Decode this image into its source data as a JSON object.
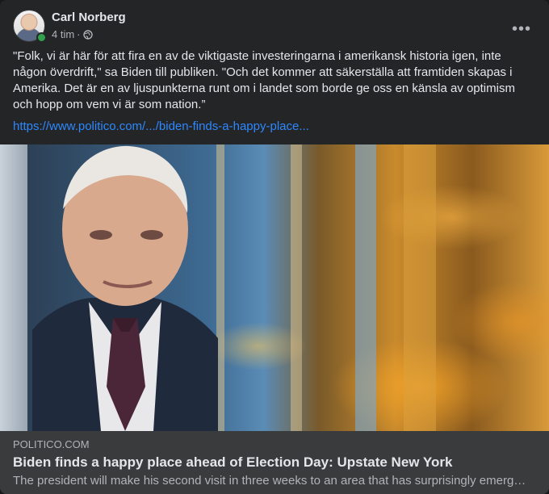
{
  "post": {
    "author": "Carl Norberg",
    "time": "4 tim",
    "separator": "·",
    "privacy_icon": "globe-icon",
    "more_icon": "•••",
    "text": "\"Folk, vi är här för att fira en av de viktigaste investeringarna i amerikansk historia igen, inte någon överdrift,\" sa Biden till publiken. \"Och det kommer att säkerställa att framtiden skapas i Amerika. Det är en av ljuspunkterna runt om i landet som borde ge oss en känsla av optimism och hopp om vem vi är som nation.”",
    "link_text": "https://www.politico.com/.../biden-finds-a-happy-place..."
  },
  "preview": {
    "domain": "POLITICO.COM",
    "headline": "Biden finds a happy place ahead of Election Day: Upstate New York",
    "description": "The president will make his second visit in three weeks to an area that has surprisingly emerg…"
  },
  "colors": {
    "card_bg": "#242526",
    "preview_bg": "#3a3b3c",
    "text_primary": "#e4e6eb",
    "text_secondary": "#b0b3b8",
    "link": "#2d88ff",
    "online": "#31a24c"
  }
}
